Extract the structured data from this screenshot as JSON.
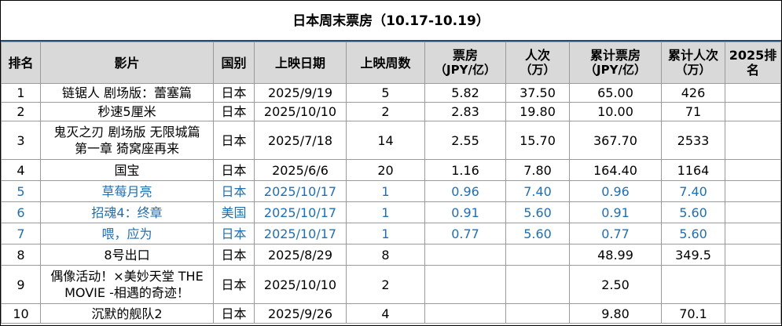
{
  "title": "日本周末票房（10.17-10.19）",
  "accent_color": "#1f6fb2",
  "headers": [
    {
      "l1": "排名",
      "l2": ""
    },
    {
      "l1": "影片",
      "l2": ""
    },
    {
      "l1": "国别",
      "l2": ""
    },
    {
      "l1": "上映日期",
      "l2": ""
    },
    {
      "l1": "上映周数",
      "l2": ""
    },
    {
      "l1": "票房",
      "l2": "（JPY/亿）"
    },
    {
      "l1": "人次",
      "l2": "（万）"
    },
    {
      "l1": "累计票房",
      "l2": "（JPY/亿）"
    },
    {
      "l1": "累计人次",
      "l2": "（万）"
    },
    {
      "l1": "2025排名",
      "l2": ""
    }
  ],
  "rows": [
    {
      "rank": "1",
      "film_l1": "链锯人 剧场版：蕾塞篇",
      "film_l2": "",
      "country": "日本",
      "date": "2025/9/19",
      "weeks": "5",
      "gross": "5.82",
      "admissions": "37.50",
      "cum_gross": "65.00",
      "cum_adm": "426",
      "rank2025": "",
      "is_new": false
    },
    {
      "rank": "2",
      "film_l1": "秒速5厘米",
      "film_l2": "",
      "country": "日本",
      "date": "2025/10/10",
      "weeks": "2",
      "gross": "2.83",
      "admissions": "19.80",
      "cum_gross": "10.00",
      "cum_adm": "71",
      "rank2025": "",
      "is_new": false
    },
    {
      "rank": "3",
      "film_l1": "鬼灭之刃 剧场版 无限城篇",
      "film_l2": "第一章 猗窝座再来",
      "country": "日本",
      "date": "2025/7/18",
      "weeks": "14",
      "gross": "2.55",
      "admissions": "15.70",
      "cum_gross": "367.70",
      "cum_adm": "2533",
      "rank2025": "",
      "is_new": false
    },
    {
      "rank": "4",
      "film_l1": "国宝",
      "film_l2": "",
      "country": "日本",
      "date": "2025/6/6",
      "weeks": "20",
      "gross": "1.16",
      "admissions": "7.80",
      "cum_gross": "164.40",
      "cum_adm": "1164",
      "rank2025": "",
      "is_new": false
    },
    {
      "rank": "5",
      "film_l1": "草莓月亮",
      "film_l2": "",
      "country": "日本",
      "date": "2025/10/17",
      "weeks": "1",
      "gross": "0.96",
      "admissions": "7.40",
      "cum_gross": "0.96",
      "cum_adm": "7.40",
      "rank2025": "",
      "is_new": true
    },
    {
      "rank": "6",
      "film_l1": "招魂4：终章",
      "film_l2": "",
      "country": "美国",
      "date": "2025/10/17",
      "weeks": "1",
      "gross": "0.91",
      "admissions": "5.60",
      "cum_gross": "0.91",
      "cum_adm": "5.60",
      "rank2025": "",
      "is_new": true
    },
    {
      "rank": "7",
      "film_l1": "喂，应为",
      "film_l2": "",
      "country": "日本",
      "date": "2025/10/17",
      "weeks": "1",
      "gross": "0.77",
      "admissions": "5.60",
      "cum_gross": "0.77",
      "cum_adm": "5.60",
      "rank2025": "",
      "is_new": true
    },
    {
      "rank": "8",
      "film_l1": "8号出口",
      "film_l2": "",
      "country": "日本",
      "date": "2025/8/29",
      "weeks": "8",
      "gross": "",
      "admissions": "",
      "cum_gross": "48.99",
      "cum_adm": "349.5",
      "rank2025": "",
      "is_new": false
    },
    {
      "rank": "9",
      "film_l1": "偶像活动！×美妙天堂 THE",
      "film_l2": "MOVIE -相遇的奇迹！",
      "country": "日本",
      "date": "2025/10/10",
      "weeks": "2",
      "gross": "",
      "admissions": "",
      "cum_gross": "2.50",
      "cum_adm": "",
      "rank2025": "",
      "is_new": false
    },
    {
      "rank": "10",
      "film_l1": "沉默的舰队2",
      "film_l2": "",
      "country": "日本",
      "date": "2025/9/26",
      "weeks": "4",
      "gross": "",
      "admissions": "",
      "cum_gross": "9.80",
      "cum_adm": "70.1",
      "rank2025": "",
      "is_new": false
    }
  ]
}
